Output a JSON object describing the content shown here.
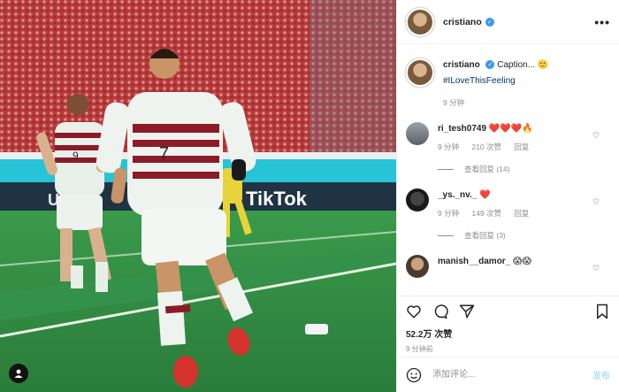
{
  "header": {
    "username": "cristiano",
    "more_label": "•••"
  },
  "caption": {
    "username": "cristiano",
    "text": "Caption...",
    "hashtag": "#ILoveThisFeeling",
    "time": "9 分钟"
  },
  "photo": {
    "board_text": "TikTok",
    "left_board_text": "UEFA",
    "player_number": "7",
    "teammate_number": "9"
  },
  "comments": [
    {
      "username": "ri_tesh0749",
      "text": "❤️❤️❤️🔥",
      "time": "9 分钟",
      "likes": "210 次赞",
      "reply": "回复",
      "view_replies": "查看回复 (14)"
    },
    {
      "username": "_ys._nv._",
      "text": "❤️",
      "time": "9 分钟",
      "likes": "149 次赞",
      "reply": "回复",
      "view_replies": "查看回复 (3)"
    },
    {
      "username": "manish__damor_",
      "text": "😱😱"
    }
  ],
  "actions": {
    "likes": "52.2万 次赞",
    "ago": "9 分钟前"
  },
  "composer": {
    "placeholder": "添加评论...",
    "post_label": "发布"
  },
  "colors": {
    "verified": "#3897f0",
    "hashtag": "#00376b",
    "post_button": "#b2dffc",
    "pitch": "#2f8a45"
  }
}
